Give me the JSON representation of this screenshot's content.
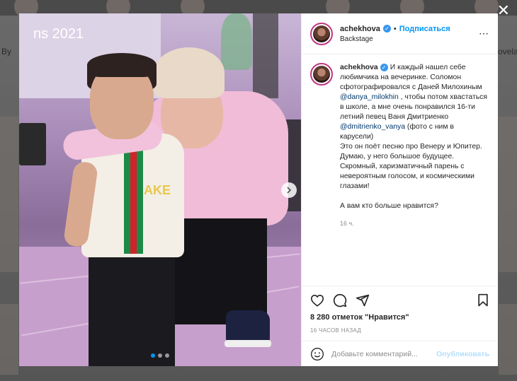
{
  "background": {
    "left_label": "By",
    "right_label": "ovela"
  },
  "photo": {
    "screen_text": "ns 2021",
    "shirt_text": "AKE",
    "dots_count": 3
  },
  "post": {
    "username": "achekhova",
    "separator": "•",
    "follow_label": "Подписаться",
    "location": "Backstage",
    "more_icon": "⋯",
    "caption_parts": [
      {
        "type": "text",
        "value": "И каждый нашел себе любимчика на вечеринке. Соломон сфотографировался с Даней Милохиным "
      },
      {
        "type": "mention",
        "value": "@danya_milokhin"
      },
      {
        "type": "text",
        "value": " , чтобы потом хвастаться в школе, а мне очень понравился 16-ти летний певец Ваня Дмитриенко "
      },
      {
        "type": "mention",
        "value": "@dmitrienko_vanya"
      },
      {
        "type": "text",
        "value": " (фото с ним в карусели)\nЭто он поёт песню про Венеру и Юпитер.\nДумаю, у него большое будущее. Скромный, харизматичный парень с невероятным голосом, и космическими глазами!\n\nА вам кто больше нравится?"
      }
    ],
    "caption_time": "16 ч.",
    "likes_text": "8 280 отметок \"Нравится\"",
    "posted_ago": "16 ЧАСОВ НАЗАД",
    "comment_placeholder": "Добавьте комментарий...",
    "post_button": "Опубликовать",
    "close_icon": "✕",
    "accent": "#0095f6"
  }
}
